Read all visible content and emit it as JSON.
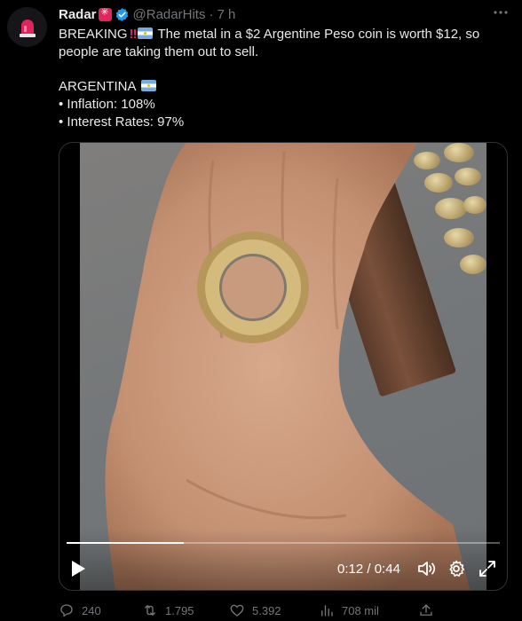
{
  "tweet": {
    "display_name": "Radar",
    "handle": "@RadarHits",
    "separator": "·",
    "time": "7 h",
    "more_icon": "ellipsis-icon",
    "text": {
      "line1_a": "BREAKING",
      "line1_bang": "‼",
      "line1_b": "The metal in a $2 Argentine Peso coin is worth $12, so",
      "line2": "people are taking them out to sell.",
      "line3": "ARGENTINA",
      "line4": "• Inflation: 108%",
      "line5": "• Interest Rates: 97%"
    }
  },
  "video": {
    "current_time": "0:12",
    "separator": "/",
    "duration": "0:44",
    "progress": 0.27
  },
  "actions": {
    "replies": "240",
    "retweets": "1.795",
    "likes": "5.392",
    "views": "708 mil"
  },
  "colors": {
    "background": "#000000",
    "text": "#e7e9ea",
    "muted": "#71767b",
    "verified": "#1d9bf0",
    "accent_red": "#e0245e"
  }
}
